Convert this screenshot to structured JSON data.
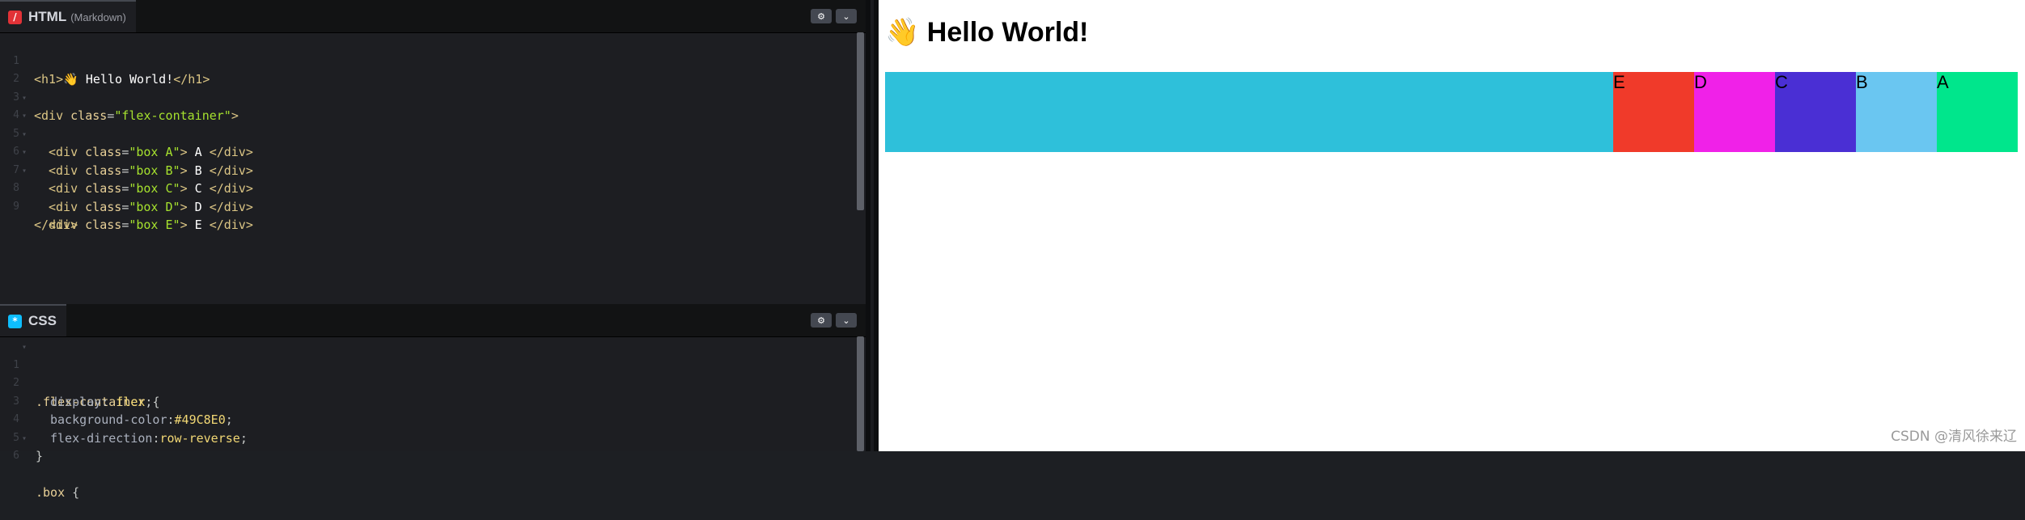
{
  "html_panel": {
    "tab_name": "HTML",
    "tab_sub": "(Markdown)",
    "tab_icon_glyph": "/",
    "tab_icon_color": "#e23237",
    "settings_glyph": "⚙",
    "collapse_glyph": "⌄",
    "line_numbers": [
      "1",
      "2",
      "3",
      "4",
      "5",
      "6",
      "7",
      "8",
      "9"
    ],
    "code": {
      "l1_open": "<h1>",
      "l1_text": "👋 Hello World!",
      "l1_close": "</h1>",
      "l3_open": "<div ",
      "l3_attr": "class",
      "l3_eq": "=",
      "l3_val": "\"flex-container\"",
      "l3_end": ">",
      "boxes": [
        {
          "attr": "class",
          "val": "\"box A\"",
          "text": " A ",
          "close": "</div>"
        },
        {
          "attr": "class",
          "val": "\"box B\"",
          "text": " B ",
          "close": "</div>"
        },
        {
          "attr": "class",
          "val": "\"box C\"",
          "text": " C ",
          "close": "</div>"
        },
        {
          "attr": "class",
          "val": "\"box D\"",
          "text": " D ",
          "close": "</div>"
        },
        {
          "attr": "class",
          "val": "\"box E\"",
          "text": " E ",
          "close": "</div>"
        }
      ],
      "box_open": "<div ",
      "box_eq": "=",
      "box_end": ">",
      "l9": "</div>"
    }
  },
  "css_panel": {
    "tab_name": "CSS",
    "tab_icon_glyph": "*",
    "tab_icon_color": "#0ebeff",
    "settings_glyph": "⚙",
    "collapse_glyph": "⌄",
    "line_numbers": [
      "1",
      "2",
      "3",
      "4",
      "5",
      "6"
    ],
    "code": {
      "l1_sel": ".flex-container",
      "l1_brace": " {",
      "l2_prop": "display",
      "l2_colon": ": ",
      "l2_val": "flex",
      "l2_semi": ";",
      "l3_prop": "background-color",
      "l3_colon": ":",
      "l3_val": "#49C8E0",
      "l3_semi": ";",
      "l4_prop": "flex-direction",
      "l4_colon": ":",
      "l4_val": "row-reverse",
      "l4_semi": ";",
      "l5": "}",
      "l6_sel": ".box",
      "l6_brace": " {"
    }
  },
  "preview": {
    "heading": "👋 Hello World!",
    "container_color": "#2ec0da",
    "boxes": [
      {
        "label": "A",
        "color": "#00e68c"
      },
      {
        "label": "B",
        "color": "#6ac6f1"
      },
      {
        "label": "C",
        "color": "#4a2fd4"
      },
      {
        "label": "D",
        "color": "#f021e8"
      },
      {
        "label": "E",
        "color": "#f03a2a"
      }
    ]
  },
  "watermark": "CSDN @清风徐来辽"
}
